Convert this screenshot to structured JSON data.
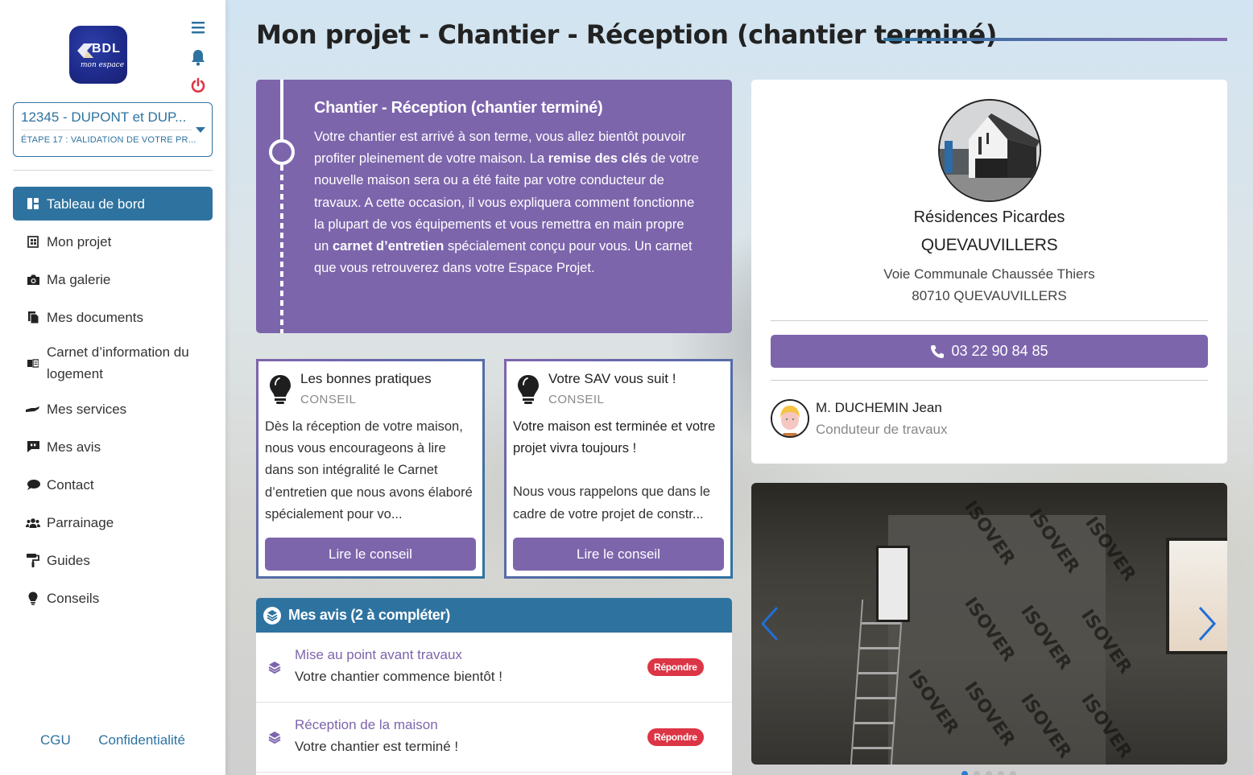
{
  "sidebar": {
    "logo": {
      "brand": "BDL",
      "tagline": "mon espace"
    },
    "top_icons": [
      "menu-icon",
      "bell-icon",
      "power-icon"
    ],
    "project": {
      "name": "12345 - DUPONT et DUP...",
      "step": "ÉTAPE 17 : VALIDATION DE VOTRE PR..."
    },
    "nav": [
      {
        "label": "Tableau de bord",
        "icon": "dashboard-icon",
        "active": true
      },
      {
        "label": "Mon projet",
        "icon": "project-icon"
      },
      {
        "label": "Ma galerie",
        "icon": "camera-icon"
      },
      {
        "label": "Mes documents",
        "icon": "documents-icon"
      },
      {
        "label": "Carnet d’information du logement",
        "icon": "book-icon"
      },
      {
        "label": "Mes services",
        "icon": "hand-icon"
      },
      {
        "label": "Mes avis",
        "icon": "quote-comment-icon"
      },
      {
        "label": "Contact",
        "icon": "comment-icon"
      },
      {
        "label": "Parrainage",
        "icon": "users-icon"
      },
      {
        "label": "Guides",
        "icon": "paint-roller-icon"
      },
      {
        "label": "Conseils",
        "icon": "lightbulb-icon"
      }
    ],
    "footer": {
      "cgu": "CGU",
      "privacy": "Confidentialité"
    }
  },
  "header": {
    "title": "Mon projet - Chantier - Réception (chantier terminé)"
  },
  "step_card": {
    "title": "Chantier - Réception (chantier terminé)",
    "text_1": "Votre chantier est arrivé à son terme, vous allez bientôt pouvoir profiter pleinement de votre maison. La ",
    "bold_1": "remise des clés",
    "text_2": " de votre nouvelle maison sera ou a été faite par votre conducteur de travaux. A cette occasion, il vous expliquera comment fonctionne la plupart de vos équipements et vous remettra en main propre un ",
    "bold_2": "carnet d’entretien",
    "text_3": " spécialement conçu pour vous. Un carnet que vous retrouverez dans votre Espace Projet."
  },
  "tips": [
    {
      "title": "Les bonnes pratiques",
      "category": "CONSEIL",
      "lead": "",
      "body": "Dès la réception de votre maison, nous vous encourageons à lire dans son intégralité le Carnet d’entretien que nous avons élaboré spécialement pour vo...",
      "button": "Lire le conseil"
    },
    {
      "title": "Votre SAV vous suit !",
      "category": "CONSEIL",
      "lead": "Votre maison est terminée et votre projet vivra toujours !",
      "body": "Nous vous rappelons que dans le cadre de votre projet de constr...",
      "button": "Lire le conseil"
    }
  ],
  "reviews": {
    "header": "Mes avis (2 à compléter)",
    "items": [
      {
        "title": "Mise au point avant travaux",
        "subtitle": "Votre chantier commence bientôt !",
        "badge": "Répondre"
      },
      {
        "title": "Réception de la maison",
        "subtitle": "Votre chantier est terminé !",
        "badge": "Répondre"
      }
    ]
  },
  "agency": {
    "name": "Résidences Picardes",
    "city": "QUEVAUVILLERS",
    "address_line1": "Voie Communale Chaussée Thiers",
    "address_line2": "80710 QUEVAUVILLERS",
    "phone": "03 22 90 84 85",
    "contact": {
      "name": "M. DUCHEMIN Jean",
      "role": "Conduteur de travaux"
    }
  },
  "gallery": {
    "watermark_text": "ISOVER",
    "slides_count": 5,
    "active_slide": 1
  },
  "colors": {
    "primary_blue": "#2e73a0",
    "purple": "#7d65ac",
    "danger": "#dc3545"
  }
}
